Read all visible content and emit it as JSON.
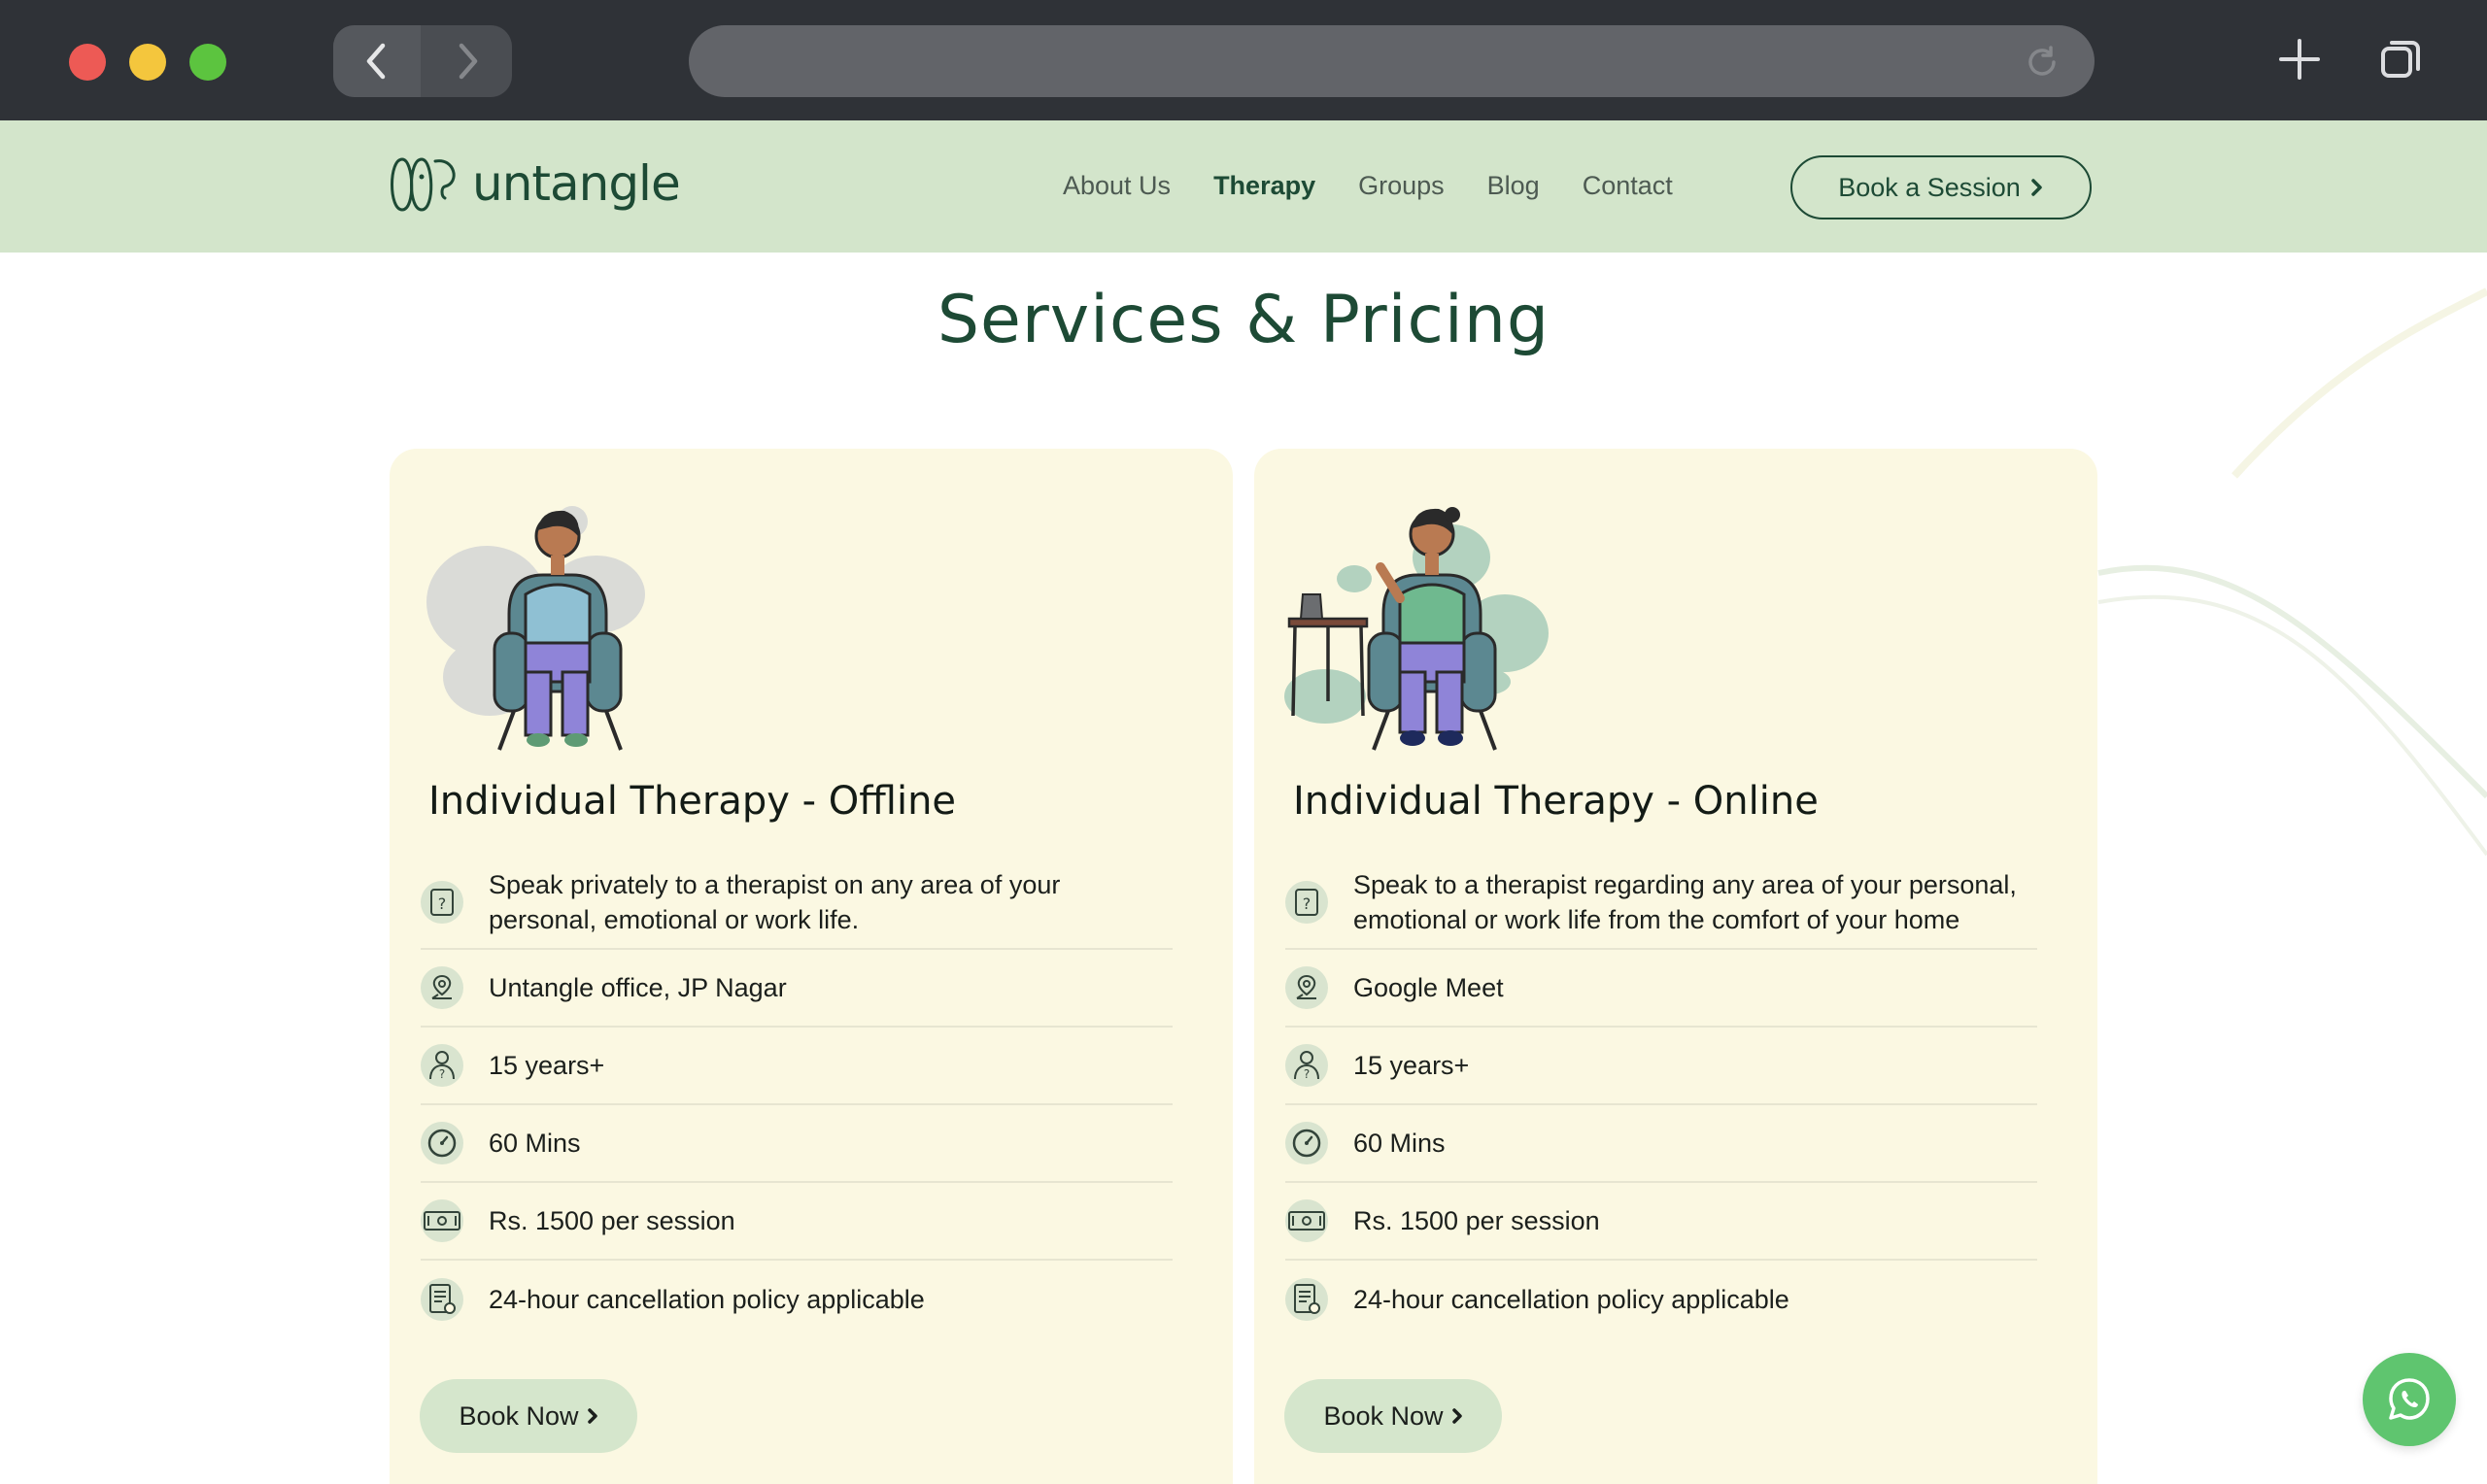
{
  "browser": {
    "icons": {
      "back": "chevron-left-icon",
      "forward": "chevron-right-icon",
      "reload": "reload-icon",
      "new_tab": "plus-icon",
      "tabs": "tabs-icon"
    },
    "colors": {
      "frame": "#2f3237",
      "url_bar": "#626469"
    }
  },
  "header": {
    "logo_text": "untangle",
    "nav": [
      {
        "label": "About Us",
        "active": false
      },
      {
        "label": "Therapy",
        "active": true
      },
      {
        "label": "Groups",
        "active": false
      },
      {
        "label": "Blog",
        "active": false
      },
      {
        "label": "Contact",
        "active": false
      }
    ],
    "cta_label": "Book a Session",
    "colors": {
      "background": "#d3e5cb",
      "brand": "#1d4a35"
    }
  },
  "main": {
    "heading": "Services & Pricing",
    "cards": [
      {
        "title": "Individual Therapy - Offline",
        "rows": [
          {
            "icon": "question-icon",
            "text": "Speak privately to a therapist on any area of your personal, emotional or work life."
          },
          {
            "icon": "location-icon",
            "text": "Untangle office, JP Nagar"
          },
          {
            "icon": "therapist-icon",
            "text": "15 years+"
          },
          {
            "icon": "clock-icon",
            "text": "60 Mins"
          },
          {
            "icon": "money-icon",
            "text": "Rs. 1500 per session"
          },
          {
            "icon": "policy-document-icon",
            "text": "24-hour cancellation policy applicable"
          }
        ],
        "button": "Book Now"
      },
      {
        "title": "Individual Therapy - Online",
        "rows": [
          {
            "icon": "question-icon",
            "text": "Speak to a therapist regarding any area of your personal, emotional or work life from the comfort of your home"
          },
          {
            "icon": "location-icon",
            "text": "Google Meet"
          },
          {
            "icon": "therapist-icon",
            "text": "15 years+"
          },
          {
            "icon": "clock-icon",
            "text": "60 Mins"
          },
          {
            "icon": "money-icon",
            "text": "Rs. 1500 per session"
          },
          {
            "icon": "policy-document-icon",
            "text": "24-hour cancellation policy applicable"
          }
        ],
        "button": "Book Now"
      }
    ],
    "colors": {
      "card_background": "#fbf8e2",
      "button_background": "#d5e6cc"
    }
  },
  "floating": {
    "icon": "whatsapp-icon",
    "color": "#5fc56f"
  }
}
